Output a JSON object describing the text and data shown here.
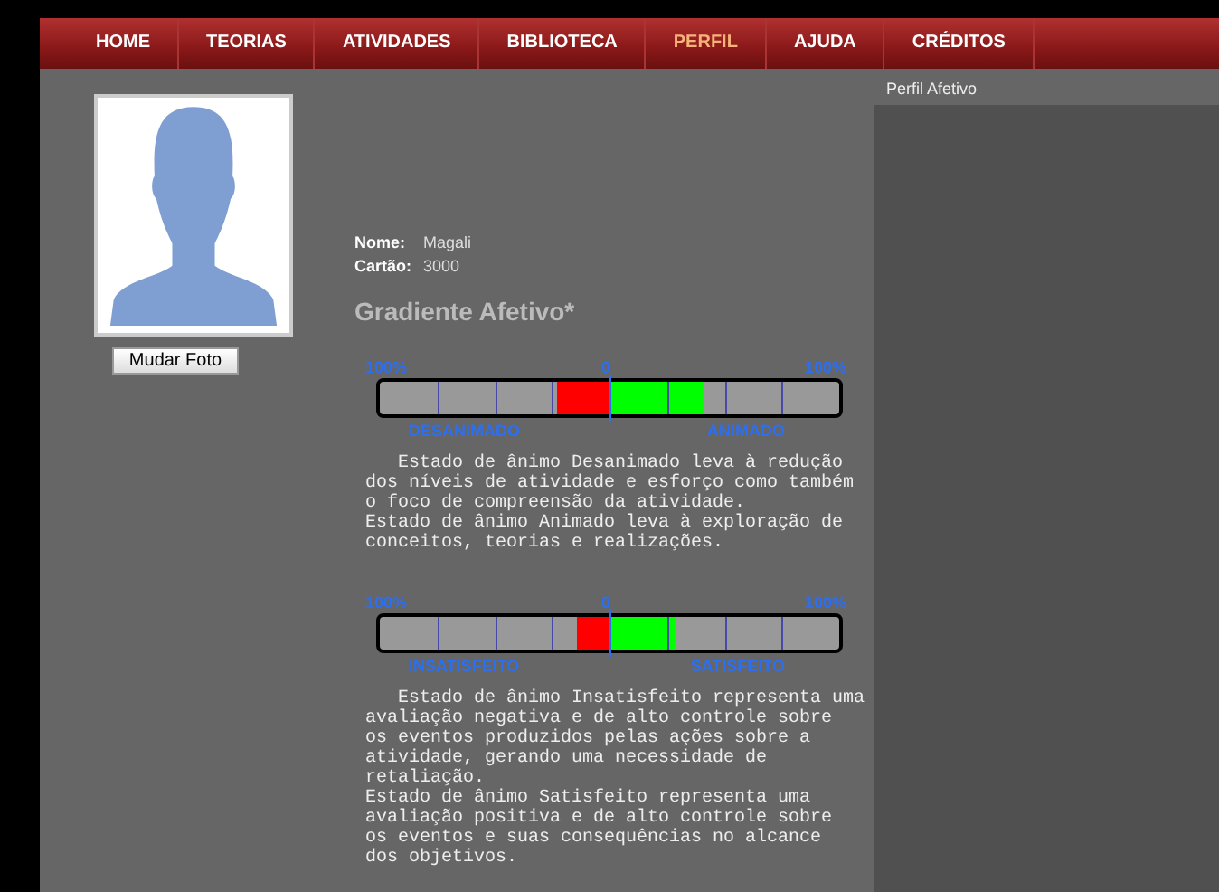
{
  "nav": [
    {
      "label": "HOME",
      "selected": false
    },
    {
      "label": "TEORIAS",
      "selected": false
    },
    {
      "label": "ATIVIDADES",
      "selected": false
    },
    {
      "label": "BIBLIOTECA",
      "selected": false
    },
    {
      "label": "PERFIL",
      "selected": true
    },
    {
      "label": "AJUDA",
      "selected": false
    },
    {
      "label": "CRÉDITOS",
      "selected": false
    }
  ],
  "photo_button": "Mudar Foto",
  "profile": [
    {
      "label": "Nome:",
      "value": "Magali"
    },
    {
      "label": "Cartão:",
      "value": "3000"
    }
  ],
  "title": "Gradiente Afetivo*",
  "gauges": [
    {
      "left_scale": "100%",
      "center_scale": "0",
      "right_scale": "100%",
      "negative": {
        "name": "DESANIMADO"
      },
      "positive": {
        "name": "ANIMADO"
      },
      "description": [
        "   Estado de ânimo Desanimado leva à redução\ndos níveis de atividade e esforço como também\no foco de compreensão da atividade.",
        "Estado de ânimo Animado leva à exploração de\nconceitos, teorias e realizações."
      ]
    },
    {
      "left_scale": "100%",
      "center_scale": "0",
      "right_scale": "100%",
      "negative": {
        "name": "INSATISFEITO"
      },
      "positive": {
        "name": "SATISFEITO"
      },
      "description": [
        "   Estado de ânimo Insatisfeito representa uma\navaliação negativa e de alto controle sobre\nos eventos produzidos pelas ações sobre a\natividade, gerando uma necessidade de\nretaliação.",
        "Estado de ânimo Satisfeito representa uma\navaliação positiva e de alto controle sobre\nos eventos e suas consequências no alcance\ndos objetivos."
      ]
    }
  ],
  "side_panel": {
    "title": "Perfil Afetivo"
  }
}
